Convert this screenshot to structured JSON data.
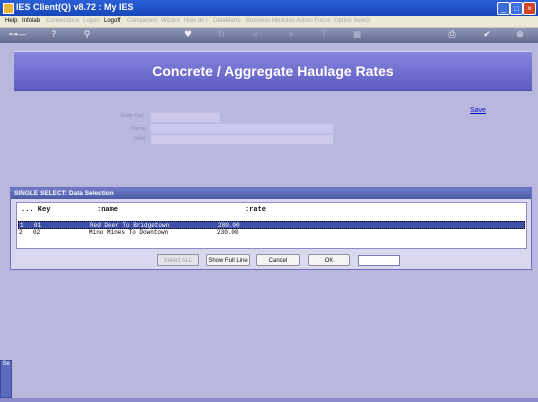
{
  "window": {
    "title": "IES Client(Q) v8.72 : My IES"
  },
  "menu": {
    "items": [
      "Help",
      "Infolab",
      "Connections",
      "Logon",
      "Logoff",
      "Companion",
      "Wizard",
      "How do I",
      "DataMarts",
      "Business Modules",
      "Action Focus",
      "Option Select"
    ]
  },
  "toolbar": {
    "icons": [
      "key-icon",
      "help-icon",
      "search-icon",
      "heart-icon",
      "refresh-icon",
      "rewind-icon",
      "fast-forward-icon",
      "save-icon",
      "stop-icon",
      "print-icon",
      "check-icon",
      "close-icon"
    ]
  },
  "header": {
    "title": "Concrete / Aggregate Haulage Rates"
  },
  "form": {
    "fields": [
      {
        "label": "Rate Key",
        "value": ""
      },
      {
        "label": "Name",
        "value": ""
      },
      {
        "label": "Rate",
        "value": ""
      }
    ],
    "save_label": "Save"
  },
  "dialog": {
    "title": "SINGLE SELECT: Data Selection",
    "columns": [
      "... Key",
      ":name",
      ":rate"
    ],
    "rows": [
      {
        "num": "1",
        "key": "01",
        "name": "Red Deer To Bridgetown",
        "rate": "280.00"
      },
      {
        "num": "2",
        "key": "02",
        "name": "Mino Mines To Downtown",
        "rate": "230.00"
      }
    ],
    "buttons": {
      "select_all": "Select ALL",
      "show_full_line": "Show Full Line",
      "cancel": "Cancel",
      "ok": "OK"
    },
    "search_value": ""
  },
  "side_tab": {
    "label": "Se"
  }
}
